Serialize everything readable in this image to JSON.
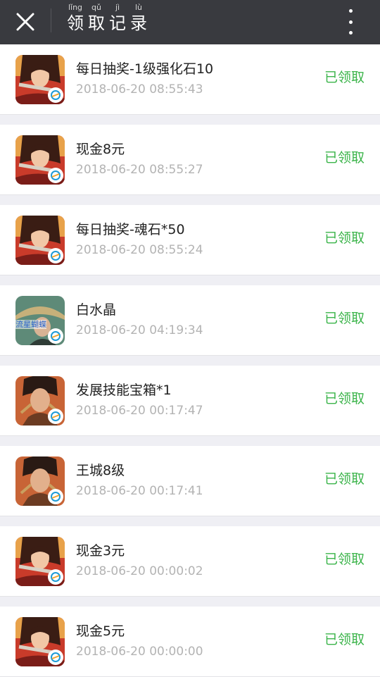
{
  "header": {
    "title_chars": [
      {
        "pinyin": "lǐng",
        "char": "领"
      },
      {
        "pinyin": "qǔ",
        "char": "取"
      },
      {
        "pinyin": "jì",
        "char": "记"
      },
      {
        "pinyin": "lù",
        "char": "录"
      }
    ],
    "icons": {
      "close": "close-icon",
      "more": "more-vertical-icon"
    }
  },
  "records": [
    {
      "name": "每日抽奖-1级强化石10",
      "time": "2018-06-20 08:55:43",
      "status": "已领取",
      "icon": "game-icon-female-warrior"
    },
    {
      "name": "现金8元",
      "time": "2018-06-20 08:55:27",
      "status": "已领取",
      "icon": "game-icon-female-warrior"
    },
    {
      "name": "每日抽奖-魂石*50",
      "time": "2018-06-20 08:55:24",
      "status": "已领取",
      "icon": "game-icon-female-warrior"
    },
    {
      "name": "白水晶",
      "time": "2018-06-20 04:19:34",
      "status": "已领取",
      "icon": "game-icon-swordsman-hat",
      "icon_text": "流星蝴蝶"
    },
    {
      "name": "发展技能宝箱*1",
      "time": "2018-06-20 00:17:47",
      "status": "已领取",
      "icon": "game-icon-male-warrior"
    },
    {
      "name": "王城8级",
      "time": "2018-06-20 00:17:41",
      "status": "已领取",
      "icon": "game-icon-male-warrior"
    },
    {
      "name": "现金3元",
      "time": "2018-06-20 00:00:02",
      "status": "已领取",
      "icon": "game-icon-female-warrior"
    },
    {
      "name": "现金5元",
      "time": "2018-06-20 00:00:00",
      "status": "已领取",
      "icon": "game-icon-female-warrior"
    }
  ],
  "colors": {
    "topbar": "#393a3f",
    "status_green": "#3bb44a",
    "time_gray": "#b3b3b3",
    "background": "#efeff4"
  }
}
